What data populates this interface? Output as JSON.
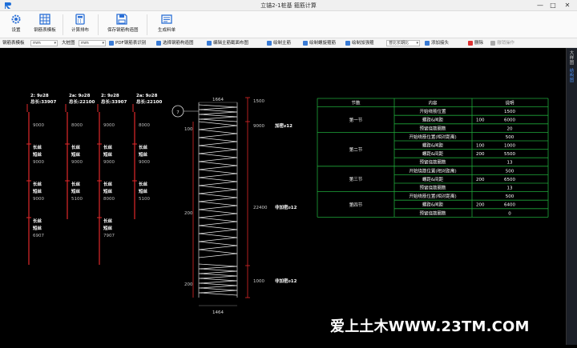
{
  "app": {
    "title": "立锚2-1桩基 箍筋计算"
  },
  "window_controls": {
    "minimize": "—",
    "maximize": "□",
    "close": "✕"
  },
  "ribbon": [
    {
      "label": "设置",
      "icon": "gear-icon"
    },
    {
      "label": "钢筋表模板",
      "icon": "table-icon"
    },
    {
      "label": "计算排布",
      "icon": "calc-icon"
    },
    {
      "label": "保存钢筋构造图",
      "icon": "save-icon"
    },
    {
      "label": "生成料单",
      "icon": "list-icon"
    }
  ],
  "toolbar": {
    "template_label": "钢筋表模板",
    "unit1": "mm",
    "drawing_label": "大桩图",
    "unit2": "mm",
    "pdf_label": "PDF钢筋表识别",
    "select_drawing": "选择钢筋构造图",
    "edit_drawing": "编辑主筋截面布图",
    "draw_main": "绘制主筋",
    "draw_spiral": "绘制螺旋箍筋",
    "draw_stirrup": "绘制加强箍",
    "length_select": "普比长期比",
    "add_hook": "添加接头",
    "delete": "删除",
    "undo": "撤销操作"
  },
  "side_tabs": [
    {
      "label": "大样图",
      "active": false
    },
    {
      "label": "结构图",
      "active": true
    }
  ],
  "bars": [
    {
      "head1": "2: 9⌀28",
      "head2": "总长:33907",
      "segs": [
        "9000",
        "长丝",
        "短丝",
        "9000",
        "长丝",
        "短丝",
        "9000",
        "长丝",
        "短丝",
        "6907"
      ]
    },
    {
      "head1": "2a: 9⌀28",
      "head2": "总长:22100",
      "segs": [
        "8000",
        "长丝",
        "短丝",
        "9000",
        "长丝",
        "短丝",
        "5100"
      ]
    },
    {
      "head1": "2: 9⌀28",
      "head2": "总长:33907",
      "segs": [
        "9000",
        "长丝",
        "短丝",
        "9000",
        "长丝",
        "短丝",
        "8000",
        "长丝",
        "短丝",
        "7907"
      ]
    },
    {
      "head1": "2a: 9⌀28",
      "head2": "总长:22100",
      "segs": [
        "8000",
        "长丝",
        "短丝",
        "9000",
        "长丝",
        "短丝",
        "5100"
      ]
    }
  ],
  "spiral": {
    "top_width": "1664",
    "bottom_width": "1464",
    "circle_label": "7",
    "left_dims": [
      "100",
      "200",
      "200"
    ],
    "right_dims": [
      "1500",
      "9000",
      "22400",
      "1000"
    ],
    "notes": [
      "加密⌀12",
      "非加密⌀12",
      "非加密⌀12"
    ]
  },
  "table": {
    "headers": [
      "节数",
      "内容",
      "说明"
    ],
    "sections": [
      {
        "name": "第一节",
        "rows": [
          [
            "开始绕筋位置",
            "",
            "1500"
          ],
          [
            "螺距&间距",
            "100",
            "6000"
          ],
          [
            "预留绕筋圈数",
            "",
            "20"
          ]
        ]
      },
      {
        "name": "第二节",
        "rows": [
          [
            "开始绕筋位置(相对距离)",
            "",
            "500"
          ],
          [
            "螺距&间距",
            "100",
            "1000"
          ],
          [
            "螺距&间距",
            "200",
            "5500"
          ],
          [
            "预留绕筋圈数",
            "",
            "13"
          ]
        ]
      },
      {
        "name": "第三节",
        "rows": [
          [
            "开始绕筋位置(相对距离)",
            "",
            "500"
          ],
          [
            "螺距&间距",
            "200",
            "6500"
          ],
          [
            "预留绕筋圈数",
            "",
            "13"
          ]
        ]
      },
      {
        "name": "第四节",
        "rows": [
          [
            "开始绕筋位置(相对距离)",
            "",
            "500"
          ],
          [
            "螺距&间距",
            "200",
            "6400"
          ],
          [
            "预留绕筋圈数",
            "",
            "0"
          ]
        ]
      }
    ]
  },
  "watermark": "爱上土木WWW.23TM.COM"
}
